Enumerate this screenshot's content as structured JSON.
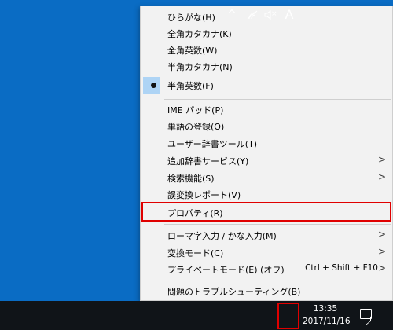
{
  "menu": {
    "items": [
      {
        "label": "ひらがな(H)"
      },
      {
        "label": "全角カタカナ(K)"
      },
      {
        "label": "全角英数(W)"
      },
      {
        "label": "半角カタカナ(N)"
      },
      {
        "label": "半角英数(F)",
        "selected": true
      },
      {
        "label": "IME パッド(P)"
      },
      {
        "label": "単語の登録(O)"
      },
      {
        "label": "ユーザー辞書ツール(T)"
      },
      {
        "label": "追加辞書サービス(Y)",
        "submenu": true
      },
      {
        "label": "検索機能(S)",
        "submenu": true
      },
      {
        "label": "誤変換レポート(V)"
      },
      {
        "label": "プロパティ(R)"
      },
      {
        "label": "ローマ字入力 / かな入力(M)",
        "submenu": true
      },
      {
        "label": "変換モード(C)",
        "submenu": true
      },
      {
        "label": "プライベートモード(E) (オフ)",
        "accelerator": "Ctrl + Shift + F10",
        "submenu": true
      },
      {
        "label": "問題のトラブルシューティング(B)"
      }
    ],
    "submenu_arrow": ">"
  },
  "taskbar": {
    "chevron_icon": "^",
    "ime_indicator": "A",
    "time": "13:35",
    "date": "2017/11/16"
  },
  "colors": {
    "desktop": "#0a6cc4",
    "highlight_border": "#e00000",
    "selected_bg": "#aed4f5"
  }
}
